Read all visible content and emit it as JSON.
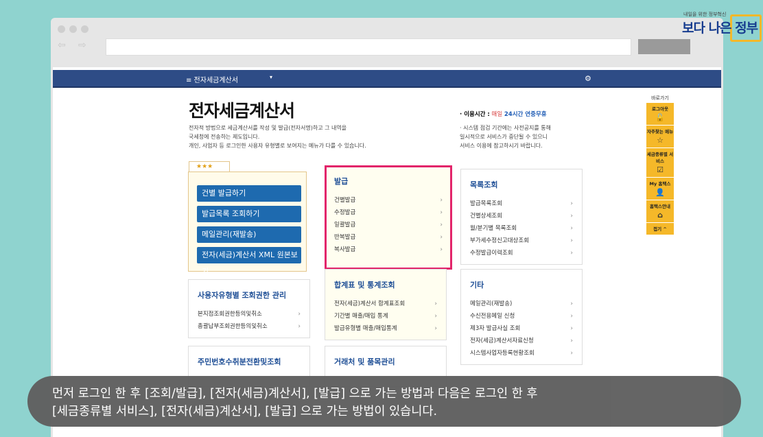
{
  "logo": {
    "small": "내일을 위한 정부혁신",
    "big": "보다 나은 정부"
  },
  "topbar": {
    "menu_label": "≡  전자세금계산서",
    "caret": "▾",
    "gear": "⚙"
  },
  "page": {
    "title": "전자세금계산서",
    "description": [
      "전자적 방법으로 세금계산서를 작성 및 발급(전자서명)하고 그 내역을",
      "국세청에 전송하는 제도입니다.",
      "개인, 사업자 등 로그인한 사용자 유형별로 보여지는 메뉴가 다를 수 있습니다."
    ],
    "usage_label": "· 이용시간 :",
    "usage_daily": "매일",
    "usage_time": "24시간 연중무휴",
    "notice": [
      "· 시스템 점검 기간에는 사전공지를 통해",
      "  일시적으로 서비스가 중단될 수 있으니",
      "  서비스 이용에 참고하시기 바랍니다."
    ]
  },
  "quick": {
    "tab": "★★★",
    "buttons": [
      "건별 발급하기",
      "발급목록 조회하기",
      "메일관리(재발송)",
      "전자(세금)계산서 XML 원본보기"
    ]
  },
  "cards": {
    "issue": {
      "title": "발급",
      "items": [
        "건별발급",
        "수정발급",
        "일괄발급",
        "반복발급",
        "복사발급"
      ]
    },
    "list": {
      "title": "목록조회",
      "items": [
        "발급목록조회",
        "건별상세조회",
        "월/분기별 목록조회",
        "부가세수정신고대상조회",
        "수정발급이력조회"
      ]
    },
    "stats": {
      "title": "합계표 및 통계조회",
      "items": [
        "전자(세금)계산서 합계표조회",
        "기간별 매출/매입 통계",
        "발급유형별 매출/매입통계"
      ]
    },
    "etc": {
      "title": "기타",
      "items": [
        "메일관리(재발송)",
        "수신전용메일 신청",
        "제3자 발급사실 조회",
        "전자(세금)계산서자료신청",
        "시스템사업자등록현황조회"
      ]
    },
    "usertype": {
      "title": "사용자유형별 조회권한 관리",
      "items": [
        "본지점조회권한등의및취소",
        "총괄납부조회권한등의및취소"
      ]
    },
    "rrn": {
      "title": "주민번호수취분전환및조회"
    },
    "partner": {
      "title": "거래처 및 품목관리"
    }
  },
  "arrow": "›",
  "sidebar": {
    "head": "바로가기",
    "items": [
      {
        "label": "로그아웃",
        "icon": "🔓"
      },
      {
        "label": "자주찾는 메뉴",
        "icon": "☆"
      },
      {
        "label": "세금종류별 서비스",
        "icon": "☑"
      },
      {
        "label": "My 홈택스",
        "icon": "👤"
      },
      {
        "label": "홈택스안내",
        "icon": "⌂"
      },
      {
        "label": "접기 ^",
        "icon": ""
      }
    ]
  },
  "subtitle": [
    "먼저 로그인 한 후 [조회/발급], [전자(세금)계산서], [발급] 으로 가는 방법과 다음은 로그인 한 후",
    "[세금종류별 서비스], [전자(세금)계산서], [발급] 으로 가는 방법이 있습니다."
  ]
}
